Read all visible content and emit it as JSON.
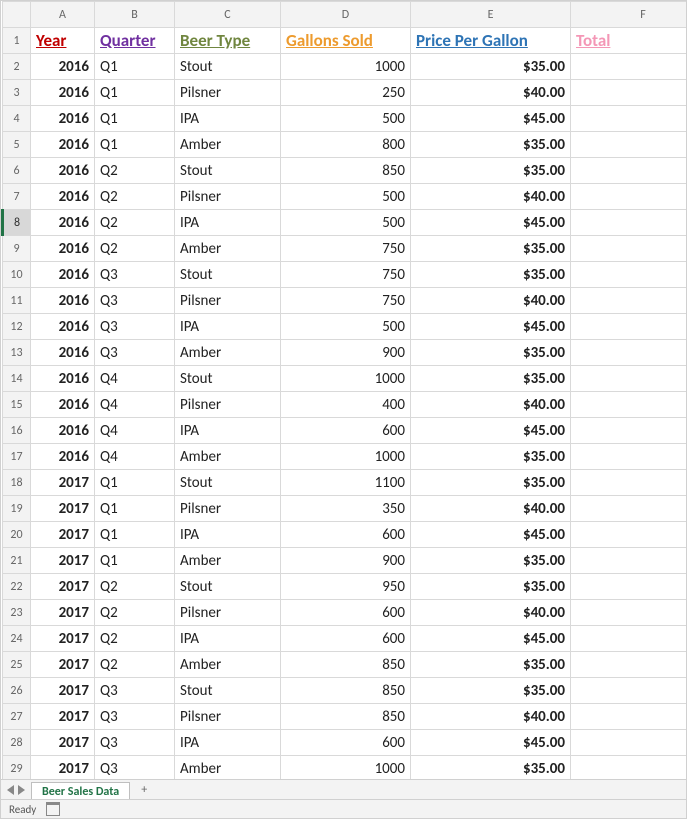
{
  "columns": [
    "A",
    "B",
    "C",
    "D",
    "E",
    "F"
  ],
  "headers": {
    "A": {
      "label": "Year",
      "class": "c-red"
    },
    "B": {
      "label": "Quarter",
      "class": "c-purple"
    },
    "C": {
      "label": "Beer Type",
      "class": "c-olive"
    },
    "D": {
      "label": "Gallons Sold",
      "class": "c-orange"
    },
    "E": {
      "label": "Price Per Gallon",
      "class": "c-blue"
    },
    "F": {
      "label": "Total",
      "class": "c-pink"
    }
  },
  "selected_row": 8,
  "rows": [
    {
      "n": 2,
      "year": "2016",
      "q": "Q1",
      "bt": "Stout",
      "gs": "1000",
      "pp": "$35.00"
    },
    {
      "n": 3,
      "year": "2016",
      "q": "Q1",
      "bt": "Pilsner",
      "gs": "250",
      "pp": "$40.00"
    },
    {
      "n": 4,
      "year": "2016",
      "q": "Q1",
      "bt": "IPA",
      "gs": "500",
      "pp": "$45.00"
    },
    {
      "n": 5,
      "year": "2016",
      "q": "Q1",
      "bt": "Amber",
      "gs": "800",
      "pp": "$35.00"
    },
    {
      "n": 6,
      "year": "2016",
      "q": "Q2",
      "bt": "Stout",
      "gs": "850",
      "pp": "$35.00"
    },
    {
      "n": 7,
      "year": "2016",
      "q": "Q2",
      "bt": "Pilsner",
      "gs": "500",
      "pp": "$40.00"
    },
    {
      "n": 8,
      "year": "2016",
      "q": "Q2",
      "bt": "IPA",
      "gs": "500",
      "pp": "$45.00"
    },
    {
      "n": 9,
      "year": "2016",
      "q": "Q2",
      "bt": "Amber",
      "gs": "750",
      "pp": "$35.00"
    },
    {
      "n": 10,
      "year": "2016",
      "q": "Q3",
      "bt": "Stout",
      "gs": "750",
      "pp": "$35.00"
    },
    {
      "n": 11,
      "year": "2016",
      "q": "Q3",
      "bt": "Pilsner",
      "gs": "750",
      "pp": "$40.00"
    },
    {
      "n": 12,
      "year": "2016",
      "q": "Q3",
      "bt": "IPA",
      "gs": "500",
      "pp": "$45.00"
    },
    {
      "n": 13,
      "year": "2016",
      "q": "Q3",
      "bt": "Amber",
      "gs": "900",
      "pp": "$35.00"
    },
    {
      "n": 14,
      "year": "2016",
      "q": "Q4",
      "bt": "Stout",
      "gs": "1000",
      "pp": "$35.00"
    },
    {
      "n": 15,
      "year": "2016",
      "q": "Q4",
      "bt": "Pilsner",
      "gs": "400",
      "pp": "$40.00"
    },
    {
      "n": 16,
      "year": "2016",
      "q": "Q4",
      "bt": "IPA",
      "gs": "600",
      "pp": "$45.00"
    },
    {
      "n": 17,
      "year": "2016",
      "q": "Q4",
      "bt": "Amber",
      "gs": "1000",
      "pp": "$35.00"
    },
    {
      "n": 18,
      "year": "2017",
      "q": "Q1",
      "bt": "Stout",
      "gs": "1100",
      "pp": "$35.00"
    },
    {
      "n": 19,
      "year": "2017",
      "q": "Q1",
      "bt": "Pilsner",
      "gs": "350",
      "pp": "$40.00"
    },
    {
      "n": 20,
      "year": "2017",
      "q": "Q1",
      "bt": "IPA",
      "gs": "600",
      "pp": "$45.00"
    },
    {
      "n": 21,
      "year": "2017",
      "q": "Q1",
      "bt": "Amber",
      "gs": "900",
      "pp": "$35.00"
    },
    {
      "n": 22,
      "year": "2017",
      "q": "Q2",
      "bt": "Stout",
      "gs": "950",
      "pp": "$35.00"
    },
    {
      "n": 23,
      "year": "2017",
      "q": "Q2",
      "bt": "Pilsner",
      "gs": "600",
      "pp": "$40.00"
    },
    {
      "n": 24,
      "year": "2017",
      "q": "Q2",
      "bt": "IPA",
      "gs": "600",
      "pp": "$45.00"
    },
    {
      "n": 25,
      "year": "2017",
      "q": "Q2",
      "bt": "Amber",
      "gs": "850",
      "pp": "$35.00"
    },
    {
      "n": 26,
      "year": "2017",
      "q": "Q3",
      "bt": "Stout",
      "gs": "850",
      "pp": "$35.00"
    },
    {
      "n": 27,
      "year": "2017",
      "q": "Q3",
      "bt": "Pilsner",
      "gs": "850",
      "pp": "$40.00"
    },
    {
      "n": 28,
      "year": "2017",
      "q": "Q3",
      "bt": "IPA",
      "gs": "600",
      "pp": "$45.00"
    },
    {
      "n": 29,
      "year": "2017",
      "q": "Q3",
      "bt": "Amber",
      "gs": "1000",
      "pp": "$35.00"
    }
  ],
  "tab": {
    "active": "Beer Sales Data",
    "add": "+"
  },
  "status": {
    "text": "Ready"
  }
}
